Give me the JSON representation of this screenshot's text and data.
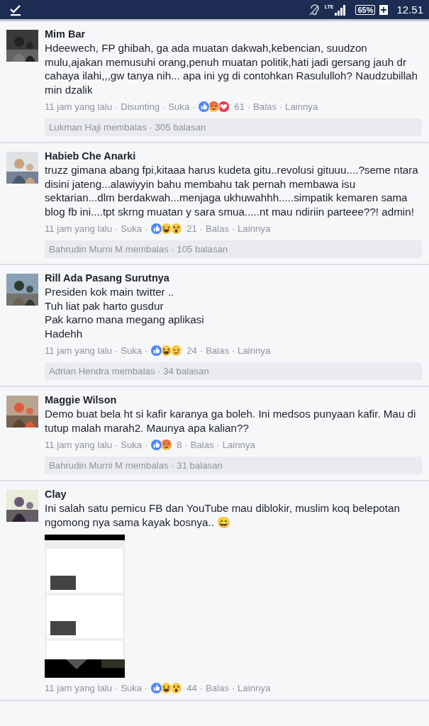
{
  "status_bar": {
    "network": "LTE",
    "battery": "65%",
    "time": "12.51"
  },
  "comments": [
    {
      "author": "Mim Bar",
      "text": "Hdeewech, FP ghibah, ga ada muatan dakwah,kebencian, suudzon mulu,ajakan memusuhi orang,penuh muatan politik,hati jadi gersang jauh dr cahaya ilahi,,,gw tanya nih... apa ini yg di contohkan Rasululloh? Naudzubillah min dzalik",
      "time": "11 jam yang lalu ·",
      "edited": "Disunting ·",
      "like": "Suka ·",
      "reactions": [
        {
          "kind": "like"
        },
        {
          "kind": "angry"
        },
        {
          "kind": "love"
        }
      ],
      "count": "61 ·",
      "reply": "Balas ·",
      "more": "Lainnya",
      "replies": "Lukman Haji membalas · 305 balasan"
    },
    {
      "author": "Habieb Che Anarki",
      "text": "truzz gimana abang fpi,kitaaa harus kudeta gitu..revolusi gituuu....?seme ntara disini jateng...alawiyyin bahu membahu tak pernah membawa isu sektarian...dlm berdakwah...menjaga ukhuwahhh.....simpatik kemaren sama blog fb ini....tpt skrng muatan y sara smua.....nt mau ndiriin parteee??! admin!",
      "time": "11 jam yang lalu ·",
      "like": "Suka ·",
      "reactions": [
        {
          "kind": "like"
        },
        {
          "kind": "haha"
        },
        {
          "kind": "wow"
        }
      ],
      "count": "21 ·",
      "reply": "Balas ·",
      "more": "Lainnya",
      "replies": "Bahrudin Murni M membalas · 105 balasan"
    },
    {
      "author": "Rill Ada Pasang Surutnya",
      "text": "Presiden kok main twitter ..\nTuh liat pak harto gusdur\nPak karno mana megang aplikasi\nHadehh",
      "time": "11 jam yang lalu ·",
      "like": "Suka ·",
      "reactions": [
        {
          "kind": "like"
        },
        {
          "kind": "haha"
        },
        {
          "kind": "sad"
        }
      ],
      "count": "24 ·",
      "reply": "Balas ·",
      "more": "Lainnya",
      "replies": "Adrian Hendra membalas · 34 balasan"
    },
    {
      "author": "Maggie Wilson",
      "text": "Demo buat bela ht si kafir karanya ga boleh. Ini medsos punyaan kafir. Mau di tutup malah marah2. Maunya apa kalian??",
      "time": "11 jam yang lalu ·",
      "like": "Suka ·",
      "reactions": [
        {
          "kind": "like"
        },
        {
          "kind": "angry"
        }
      ],
      "count": "8 ·",
      "reply": "Balas ·",
      "more": "Lainnya",
      "replies": "Bahrudin Murni M membalas · 31 balasan"
    },
    {
      "author": "Clay",
      "text": "Ini salah satu pemicu FB dan YouTube mau diblokir, muslim koq belepotan ngomong nya sama kayak bosnya.. 😄",
      "time": "11 jam yang lalu ·",
      "like": "Suka ·",
      "reactions": [
        {
          "kind": "like"
        },
        {
          "kind": "haha"
        },
        {
          "kind": "wow"
        }
      ],
      "count": "44 ·",
      "reply": "Balas ·",
      "more": "Lainnya"
    }
  ]
}
